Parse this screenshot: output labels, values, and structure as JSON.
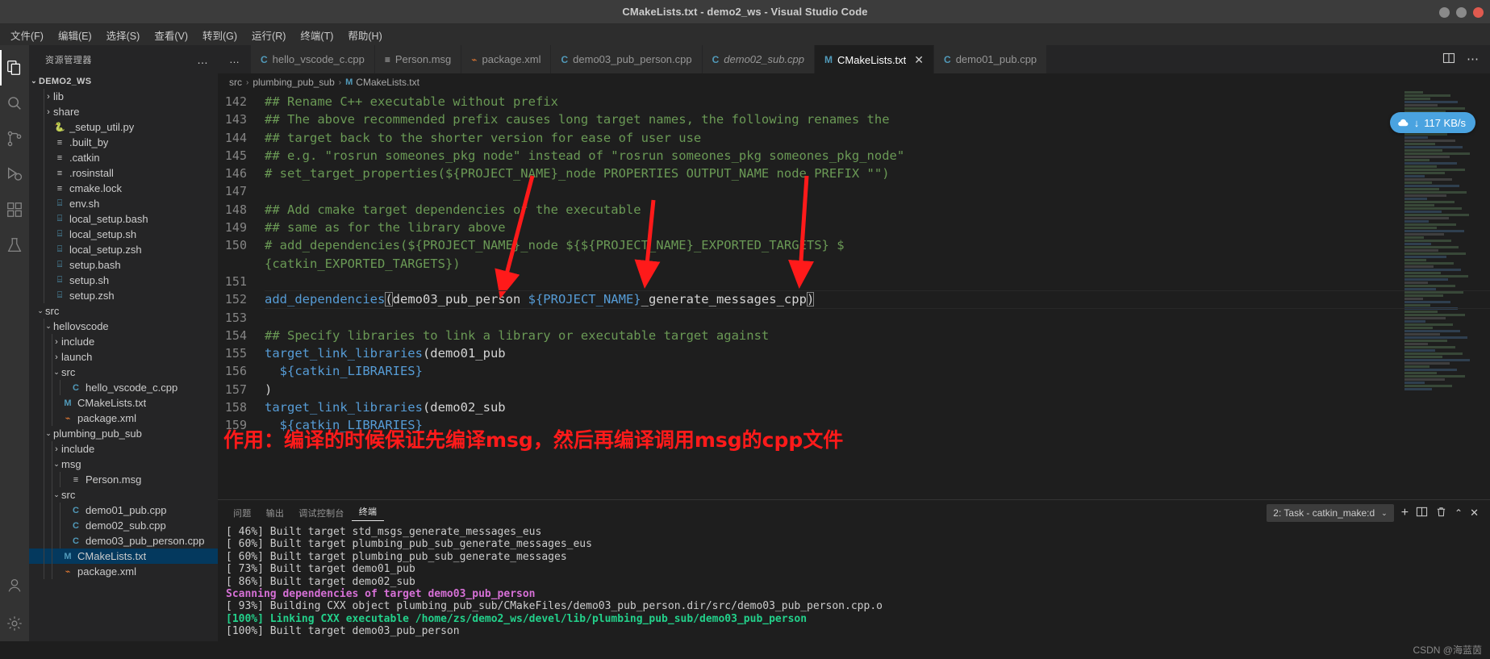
{
  "window": {
    "title": "CMakeLists.txt - demo2_ws - Visual Studio Code"
  },
  "menubar": {
    "items": [
      {
        "label": "文件(F)"
      },
      {
        "label": "编辑(E)"
      },
      {
        "label": "选择(S)"
      },
      {
        "label": "查看(V)"
      },
      {
        "label": "转到(G)"
      },
      {
        "label": "运行(R)"
      },
      {
        "label": "终端(T)"
      },
      {
        "label": "帮助(H)"
      }
    ]
  },
  "activitybar": {
    "items": [
      {
        "name": "explorer",
        "icon": "files-icon"
      },
      {
        "name": "search",
        "icon": "search-icon"
      },
      {
        "name": "source-control",
        "icon": "source-control-icon"
      },
      {
        "name": "run-debug",
        "icon": "run-debug-icon"
      },
      {
        "name": "extensions",
        "icon": "extensions-icon"
      },
      {
        "name": "testing",
        "icon": "beaker-icon"
      },
      {
        "name": "accounts",
        "icon": "account-icon"
      },
      {
        "name": "settings",
        "icon": "gear-icon"
      }
    ]
  },
  "sidebar": {
    "header": "资源管理器",
    "more_label": "…",
    "root": "DEMO2_WS",
    "tree": [
      {
        "label": "lib",
        "icon": "folder",
        "twisty": "collapsed",
        "indent": 1
      },
      {
        "label": "share",
        "icon": "folder",
        "twisty": "collapsed",
        "indent": 1
      },
      {
        "label": "_setup_util.py",
        "icon": "python",
        "twisty": "none",
        "indent": 1
      },
      {
        "label": ".built_by",
        "icon": "config",
        "twisty": "none",
        "indent": 1
      },
      {
        "label": ".catkin",
        "icon": "config",
        "twisty": "none",
        "indent": 1
      },
      {
        "label": ".rosinstall",
        "icon": "config",
        "twisty": "none",
        "indent": 1
      },
      {
        "label": "cmake.lock",
        "icon": "config",
        "twisty": "none",
        "indent": 1
      },
      {
        "label": "env.sh",
        "icon": "shell",
        "twisty": "none",
        "indent": 1
      },
      {
        "label": "local_setup.bash",
        "icon": "shell",
        "twisty": "none",
        "indent": 1
      },
      {
        "label": "local_setup.sh",
        "icon": "shell",
        "twisty": "none",
        "indent": 1
      },
      {
        "label": "local_setup.zsh",
        "icon": "shell",
        "twisty": "none",
        "indent": 1
      },
      {
        "label": "setup.bash",
        "icon": "shell",
        "twisty": "none",
        "indent": 1
      },
      {
        "label": "setup.sh",
        "icon": "shell",
        "twisty": "none",
        "indent": 1
      },
      {
        "label": "setup.zsh",
        "icon": "shell",
        "twisty": "none",
        "indent": 1
      },
      {
        "label": "src",
        "icon": "folder",
        "twisty": "expanded",
        "indent": 0
      },
      {
        "label": "hellovscode",
        "icon": "folder",
        "twisty": "expanded",
        "indent": 1
      },
      {
        "label": "include",
        "icon": "folder",
        "twisty": "collapsed",
        "indent": 2
      },
      {
        "label": "launch",
        "icon": "folder",
        "twisty": "collapsed",
        "indent": 2
      },
      {
        "label": "src",
        "icon": "folder",
        "twisty": "expanded",
        "indent": 2
      },
      {
        "label": "hello_vscode_c.cpp",
        "icon": "cpp",
        "twisty": "none",
        "indent": 3
      },
      {
        "label": "CMakeLists.txt",
        "icon": "md",
        "twisty": "none",
        "indent": 2
      },
      {
        "label": "package.xml",
        "icon": "xml",
        "twisty": "none",
        "indent": 2
      },
      {
        "label": "plumbing_pub_sub",
        "icon": "folder",
        "twisty": "expanded",
        "indent": 1
      },
      {
        "label": "include",
        "icon": "folder",
        "twisty": "collapsed",
        "indent": 2
      },
      {
        "label": "msg",
        "icon": "folder",
        "twisty": "expanded",
        "indent": 2
      },
      {
        "label": "Person.msg",
        "icon": "msg",
        "twisty": "none",
        "indent": 3
      },
      {
        "label": "src",
        "icon": "folder",
        "twisty": "expanded",
        "indent": 2
      },
      {
        "label": "demo01_pub.cpp",
        "icon": "cpp",
        "twisty": "none",
        "indent": 3
      },
      {
        "label": "demo02_sub.cpp",
        "icon": "cpp",
        "twisty": "none",
        "indent": 3
      },
      {
        "label": "demo03_pub_person.cpp",
        "icon": "cpp",
        "twisty": "none",
        "indent": 3
      },
      {
        "label": "CMakeLists.txt",
        "icon": "md",
        "twisty": "none",
        "indent": 2,
        "selected": true
      },
      {
        "label": "package.xml",
        "icon": "xml",
        "twisty": "none",
        "indent": 2
      }
    ]
  },
  "tabs": {
    "overflow_label": "…",
    "items": [
      {
        "label": "hello_vscode_c.cpp",
        "icon": "cpp",
        "active": false,
        "preview": false
      },
      {
        "label": "Person.msg",
        "icon": "msg",
        "active": false,
        "preview": false
      },
      {
        "label": "package.xml",
        "icon": "xml",
        "active": false,
        "preview": false
      },
      {
        "label": "demo03_pub_person.cpp",
        "icon": "cpp",
        "active": false,
        "preview": false
      },
      {
        "label": "demo02_sub.cpp",
        "icon": "cpp",
        "active": false,
        "preview": true
      },
      {
        "label": "CMakeLists.txt",
        "icon": "md",
        "active": true,
        "preview": false,
        "close": "✕"
      },
      {
        "label": "demo01_pub.cpp",
        "icon": "cpp",
        "active": false,
        "preview": false
      }
    ]
  },
  "breadcrumb": {
    "items": [
      "src",
      "plumbing_pub_sub",
      "CMakeLists.txt"
    ],
    "separator": "›"
  },
  "toast": {
    "speed": "117 KB/s",
    "arrow": "↓"
  },
  "editor": {
    "lines": [
      {
        "num": "142",
        "segments": [
          {
            "t": "## Rename C++ executable without prefix",
            "c": "cmt"
          }
        ]
      },
      {
        "num": "143",
        "segments": [
          {
            "t": "## The above recommended prefix causes long target names, the following renames the",
            "c": "cmt"
          }
        ]
      },
      {
        "num": "144",
        "segments": [
          {
            "t": "## target back to the shorter version for ease of user use",
            "c": "cmt"
          }
        ]
      },
      {
        "num": "145",
        "segments": [
          {
            "t": "## e.g. \"rosrun someones_pkg node\" instead of \"rosrun someones_pkg someones_pkg_node\"",
            "c": "cmt"
          }
        ]
      },
      {
        "num": "146",
        "segments": [
          {
            "t": "# set_target_properties(${PROJECT_NAME}_node PROPERTIES OUTPUT_NAME node PREFIX \"\")",
            "c": "cmt"
          }
        ]
      },
      {
        "num": "147",
        "segments": [
          {
            "t": "",
            "c": "plain"
          }
        ]
      },
      {
        "num": "148",
        "segments": [
          {
            "t": "## Add cmake target dependencies of the executable",
            "c": "cmt"
          }
        ]
      },
      {
        "num": "149",
        "segments": [
          {
            "t": "## same as for the library above",
            "c": "cmt"
          }
        ]
      },
      {
        "num": "150",
        "segments": [
          {
            "t": "# add_dependencies(${PROJECT_NAME}_node ${${PROJECT_NAME}_EXPORTED_TARGETS} $",
            "c": "cmt"
          }
        ]
      },
      {
        "num": "",
        "segments": [
          {
            "t": "{catkin_EXPORTED_TARGETS})",
            "c": "cmt"
          }
        ]
      },
      {
        "num": "151",
        "segments": [
          {
            "t": "",
            "c": "plain"
          }
        ]
      },
      {
        "num": "152",
        "current": true,
        "segments": [
          {
            "t": "add_dependencies",
            "c": "fn"
          },
          {
            "t": "(",
            "c": "bracket-match"
          },
          {
            "t": "demo03_pub_person ",
            "c": "plain"
          },
          {
            "t": "${PROJECT_NAME}",
            "c": "var"
          },
          {
            "t": "_generate_messages_cpp",
            "c": "plain"
          },
          {
            "t": ")",
            "c": "bracket-match"
          }
        ]
      },
      {
        "num": "153",
        "segments": [
          {
            "t": "",
            "c": "plain"
          }
        ]
      },
      {
        "num": "154",
        "segments": [
          {
            "t": "## Specify libraries to link a library or executable target against",
            "c": "cmt"
          }
        ]
      },
      {
        "num": "155",
        "segments": [
          {
            "t": "target_link_libraries",
            "c": "fn"
          },
          {
            "t": "(demo01_pub",
            "c": "plain"
          }
        ]
      },
      {
        "num": "156",
        "segments": [
          {
            "t": "  ",
            "c": "plain"
          },
          {
            "t": "${catkin_LIBRARIES}",
            "c": "var"
          }
        ]
      },
      {
        "num": "157",
        "segments": [
          {
            "t": ")",
            "c": "plain"
          }
        ]
      },
      {
        "num": "158",
        "segments": [
          {
            "t": "target_link_libraries",
            "c": "fn"
          },
          {
            "t": "(demo02_sub",
            "c": "plain"
          }
        ]
      },
      {
        "num": "159",
        "segments": [
          {
            "t": "  ",
            "c": "plain"
          },
          {
            "t": "${catkin_LIBRARIES}",
            "c": "var"
          }
        ]
      }
    ]
  },
  "annotation": {
    "text": "作用：编译的时候保证先编译msg，然后再编译调用msg的cpp文件",
    "color": "#ff1a1a"
  },
  "panel": {
    "tabs": [
      {
        "label": "问题",
        "active": false
      },
      {
        "label": "输出",
        "active": false
      },
      {
        "label": "调试控制台",
        "active": false
      },
      {
        "label": "终端",
        "active": true
      }
    ],
    "task_select": "2: Task - catkin_make:d",
    "actions": {
      "add": "+",
      "split": "▥",
      "kill": "🗑",
      "chevron": "⌃",
      "close": "✕"
    },
    "terminal_lines": [
      {
        "t": "[ 46%] Built target std_msgs_generate_messages_eus",
        "c": "plain"
      },
      {
        "t": "[ 60%] Built target plumbing_pub_sub_generate_messages_eus",
        "c": "plain"
      },
      {
        "t": "[ 60%] Built target plumbing_pub_sub_generate_messages",
        "c": "plain"
      },
      {
        "t": "[ 73%] Built target demo01_pub",
        "c": "plain"
      },
      {
        "t": "[ 86%] Built target demo02_sub",
        "c": "plain"
      },
      {
        "t": "Scanning dependencies of target demo03_pub_person",
        "c": "magenta"
      },
      {
        "t": "[ 93%] Building CXX object plumbing_pub_sub/CMakeFiles/demo03_pub_person.dir/src/demo03_pub_person.cpp.o",
        "c": "plain"
      },
      {
        "t": "[100%] Linking CXX executable /home/zs/demo2_ws/devel/lib/plumbing_pub_sub/demo03_pub_person",
        "c": "green"
      },
      {
        "t": "[100%] Built target demo03_pub_person",
        "c": "plain"
      }
    ]
  },
  "watermark": "CSDN @海蓝茵"
}
